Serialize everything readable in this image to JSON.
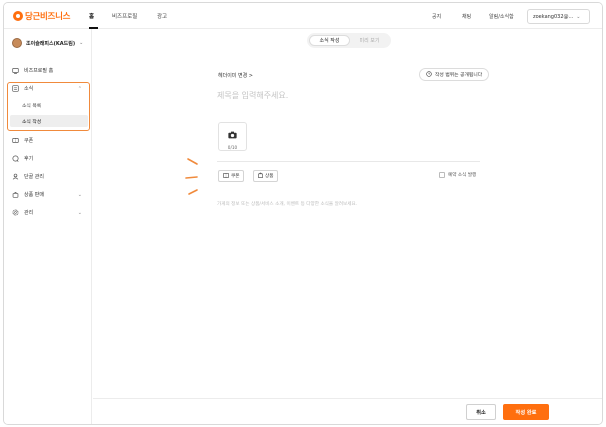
{
  "brand": {
    "logo_text": "당근비즈니스",
    "accent_color": "#ff6f0f"
  },
  "topnav": {
    "tabs": [
      {
        "label": "홈",
        "active": true
      },
      {
        "label": "비즈프로필",
        "active": false
      },
      {
        "label": "광고",
        "active": false
      }
    ],
    "links": [
      "공지",
      "채팅",
      "알림/소식함"
    ],
    "account": "zoekang032@..."
  },
  "sidebar": {
    "profile_name": "조이슬래피스(KA드림)",
    "items": [
      {
        "label": "비즈프로필 홈",
        "icon": "profile-home-icon"
      },
      {
        "label": "소식",
        "icon": "news-icon",
        "expanded": true,
        "children": [
          {
            "label": "소식 목록",
            "active": false
          },
          {
            "label": "소식 작성",
            "active": true
          }
        ]
      },
      {
        "label": "쿠폰",
        "icon": "coupon-icon"
      },
      {
        "label": "후기",
        "icon": "review-icon"
      },
      {
        "label": "단골 관리",
        "icon": "regulars-icon"
      },
      {
        "label": "상품 판매",
        "icon": "shop-icon"
      },
      {
        "label": "관리",
        "icon": "settings-icon"
      }
    ]
  },
  "editor": {
    "mode_tabs": [
      {
        "label": "소식 작성",
        "active": true
      },
      {
        "label": "미리 보기",
        "active": false
      }
    ],
    "header_change": "헤더이미 변경 >",
    "audience": "작성 범위는 공개됩니다",
    "title_placeholder": "제목을 입력해주세요.",
    "photo_count": "0/10",
    "attach_buttons": [
      "쿠폰",
      "상품"
    ],
    "reserve_label": "예약 소식 발행",
    "body_placeholder": "가게의 정보 또는 상품/서비스 소개, 이벤트 등 다양한 소식을 알려보세요."
  },
  "footer": {
    "cancel_label": "취소",
    "submit_label": "작성 완료"
  }
}
